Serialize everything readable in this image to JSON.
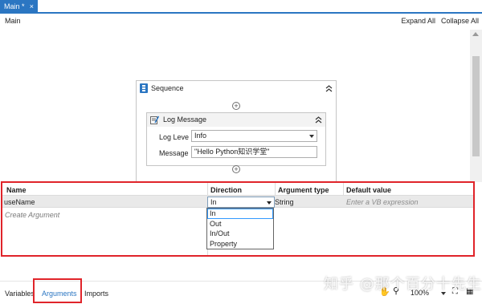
{
  "tab": {
    "label": "Main *",
    "close": "×"
  },
  "header": {
    "title": "Main",
    "expand_all": "Expand All",
    "collapse_all": "Collapse All"
  },
  "sequence": {
    "title": "Sequence",
    "log_message": {
      "title": "Log Message",
      "level_label": "Log Leve",
      "level_value": "Info",
      "message_label": "Message",
      "message_value": "\"Hello Python知识学堂\""
    }
  },
  "arguments": {
    "columns": [
      "Name",
      "Direction",
      "Argument type",
      "Default value"
    ],
    "row": {
      "name": "useName",
      "direction": "In",
      "type": "String",
      "default_placeholder": "Enter a VB expression"
    },
    "create_label": "Create Argument",
    "direction_options": [
      "In",
      "Out",
      "In/Out",
      "Property"
    ]
  },
  "bottom": {
    "tabs": [
      "Variables",
      "Arguments",
      "Imports"
    ],
    "zoom": "100%"
  },
  "watermark": "知乎 @那个百分十先生",
  "colors": {
    "accent": "#2b76c2",
    "highlight_border": "#e0242a"
  }
}
